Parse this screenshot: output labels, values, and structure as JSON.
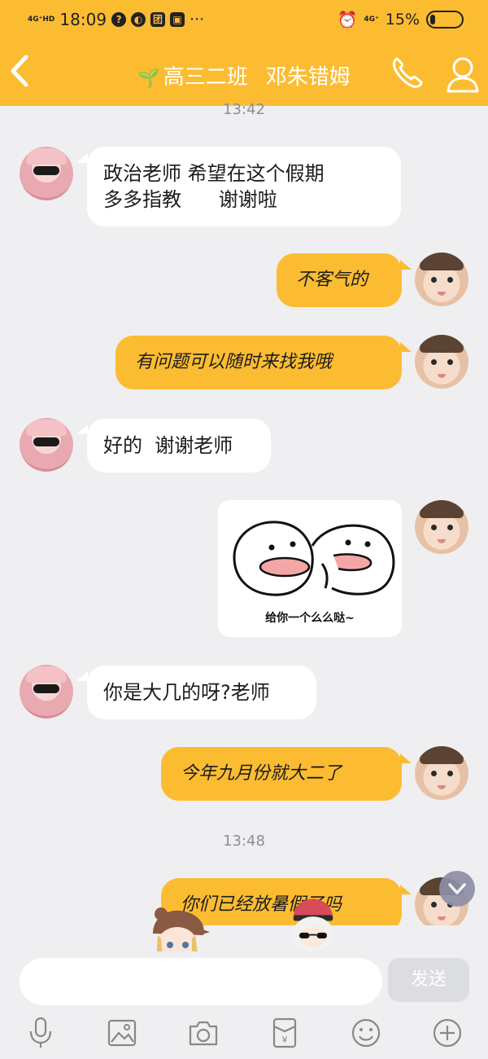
{
  "status_bar": {
    "network": "4G⁺HD",
    "time": "18:09",
    "icons_left": [
      "help-circle-icon",
      "compass-icon",
      "tuan-icon",
      "game-icon",
      "more-dots-icon"
    ],
    "more": "···",
    "alarm": "alarm-icon",
    "network_right": "4G⁺",
    "battery_percent": "15%",
    "battery_level": 0.15
  },
  "header": {
    "group_name": "高三二班",
    "member_name": "邓朱错姆",
    "accent_color": "#fcbc32"
  },
  "messages": [
    {
      "type": "timestamp",
      "text": "13:42"
    },
    {
      "type": "incoming",
      "lines": [
        "政治老师 希望在这个假期",
        "多多指教      谢谢啦"
      ]
    },
    {
      "type": "outgoing",
      "text": "不客气的"
    },
    {
      "type": "outgoing",
      "text": "有问题可以随时来找我哦"
    },
    {
      "type": "incoming",
      "text": "好的  谢谢老师"
    },
    {
      "type": "outgoing_sticker",
      "caption": "给你一个么么哒~"
    },
    {
      "type": "incoming",
      "text": "你是大几的呀?老师"
    },
    {
      "type": "outgoing",
      "text": "今年九月份就大二了"
    },
    {
      "type": "timestamp",
      "text": "13:48"
    },
    {
      "type": "outgoing",
      "text": "你们已经放暑假了吗"
    }
  ],
  "composer": {
    "input_value": "",
    "send_label": "发送"
  },
  "toolbar": [
    "microphone-icon",
    "image-icon",
    "camera-icon",
    "red-packet-icon",
    "emoji-icon",
    "plus-icon"
  ]
}
